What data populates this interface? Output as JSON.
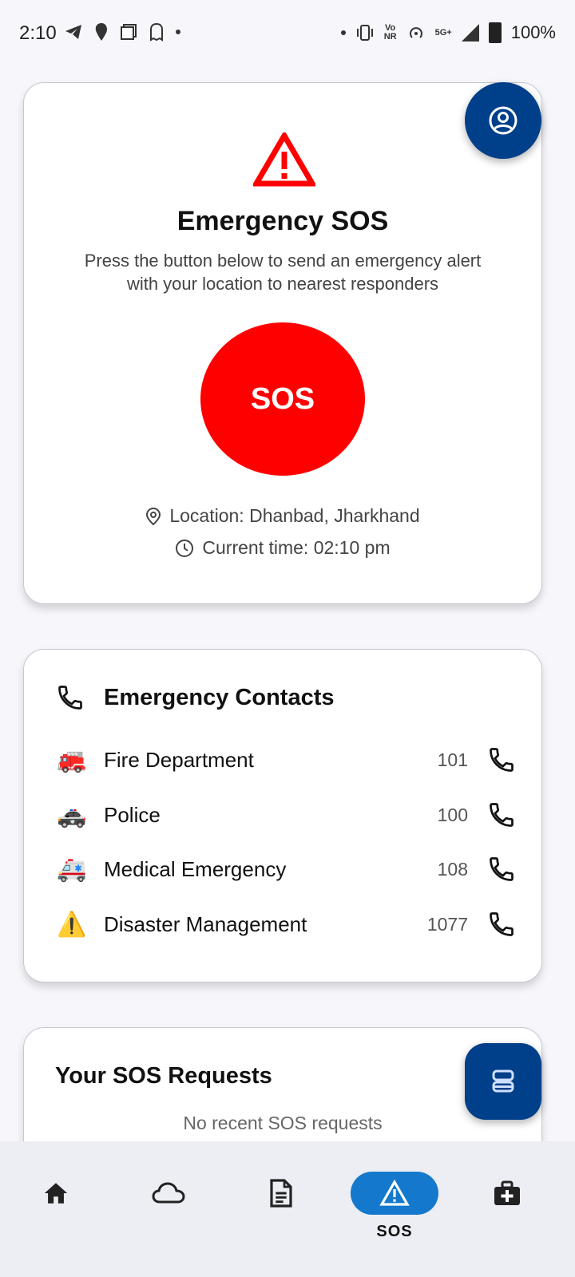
{
  "status_bar": {
    "time": "2:10",
    "network": "5G+",
    "battery": "100%"
  },
  "sos_card": {
    "title": "Emergency SOS",
    "description": "Press the button below to send an emergency alert with your location to nearest responders",
    "button_label": "SOS",
    "location": "Location: Dhanbad, Jharkhand",
    "current_time": "Current time: 02:10 pm",
    "accent_color": "#ff0000"
  },
  "contacts": {
    "title": "Emergency Contacts",
    "items": [
      {
        "icon": "fire-engine-icon",
        "emoji": "🚒",
        "name": "Fire Department",
        "number": "101"
      },
      {
        "icon": "police-car-icon",
        "emoji": "🚓",
        "name": "Police",
        "number": "100"
      },
      {
        "icon": "ambulance-icon",
        "emoji": "🚑",
        "name": "Medical Emergency",
        "number": "108"
      },
      {
        "icon": "warning-icon",
        "emoji": "⚠️",
        "name": "Disaster Management",
        "number": "1077"
      }
    ]
  },
  "requests": {
    "title": "Your SOS Requests",
    "empty_text": "No recent SOS requests"
  },
  "bottom_nav": {
    "items": [
      {
        "icon": "home-icon"
      },
      {
        "icon": "cloud-icon"
      },
      {
        "icon": "document-icon"
      },
      {
        "icon": "warning-icon",
        "label": "SOS",
        "active": true
      },
      {
        "icon": "medical-kit-icon"
      }
    ],
    "active_color": "#1479cc"
  },
  "fab_color": "#003f8a"
}
